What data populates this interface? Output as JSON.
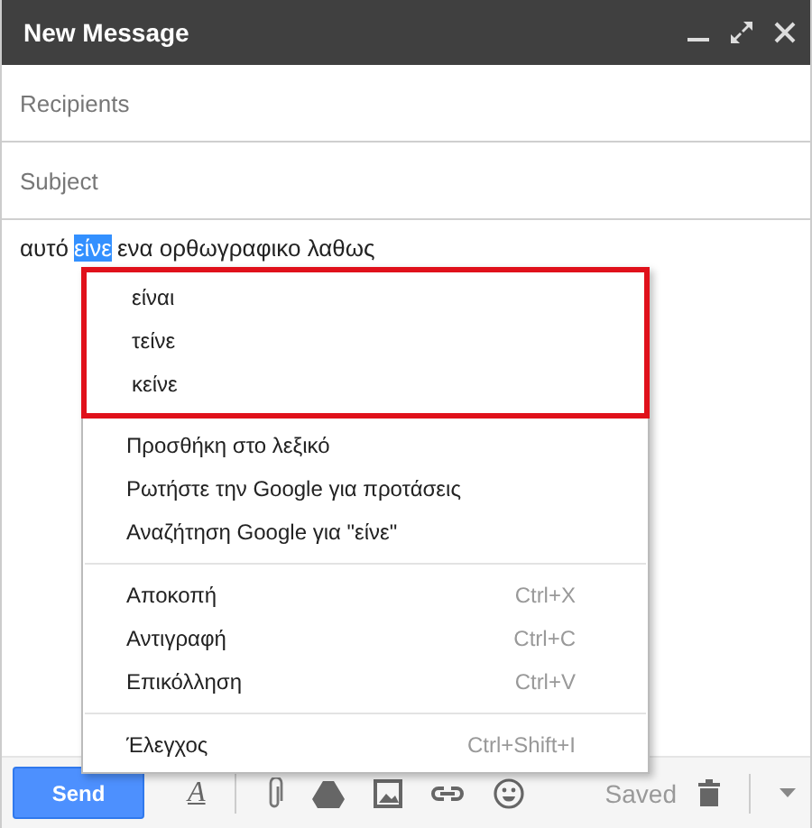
{
  "window": {
    "title": "New Message"
  },
  "fields": [
    {
      "placeholder": "Recipients"
    },
    {
      "placeholder": "Subject"
    }
  ],
  "body": {
    "before": "αυτό",
    "selected_word": "είνε",
    "after": "ενα ορθωγραφικο λαθως"
  },
  "context_menu": {
    "suggestions": [
      "είναι",
      "τείνε",
      "κείνε"
    ],
    "groups": [
      [
        {
          "label": "Προσθήκη στο λεξικό"
        },
        {
          "label": "Ρωτήστε την Google για προτάσεις"
        },
        {
          "label": "Αναζήτηση Google για \"είνε\""
        }
      ],
      [
        {
          "label": "Αποκοπή",
          "shortcut": "Ctrl+X"
        },
        {
          "label": "Αντιγραφή",
          "shortcut": "Ctrl+C"
        },
        {
          "label": "Επικόλληση",
          "shortcut": "Ctrl+V"
        }
      ],
      [
        {
          "label": "Έλεγχος",
          "shortcut": "Ctrl+Shift+I"
        }
      ]
    ]
  },
  "toolbar": {
    "send": "Send",
    "format": "A",
    "status": "Saved"
  }
}
